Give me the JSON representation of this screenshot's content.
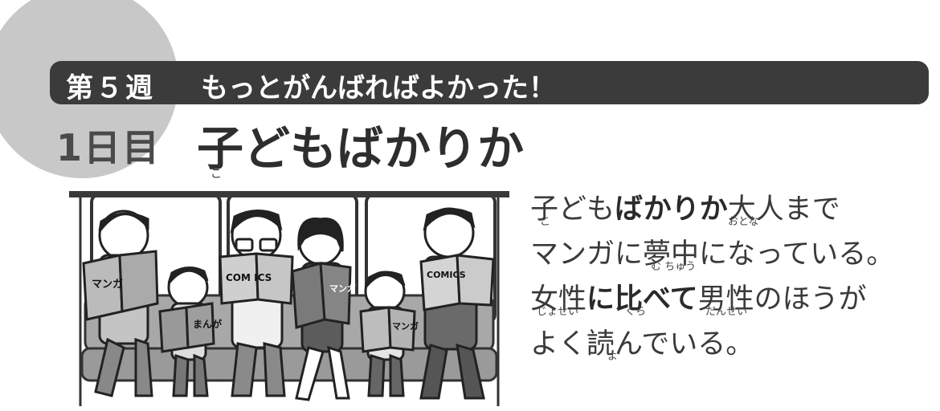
{
  "header": {
    "week_label": "第５週",
    "week_subtitle": "もっとがんばればよかった！",
    "day_label": "1日目",
    "title": "子どもばかりか",
    "title_ruby": "こ"
  },
  "illustration": {
    "book_labels": [
      "マンガ",
      "まんが",
      "COM ICS",
      "マンガ",
      "マンガ",
      "COMICS"
    ]
  },
  "body": {
    "line1": {
      "part1": "子ども",
      "bold": "ばかりか",
      "part2": "大人まで",
      "ruby_ko": "こ",
      "ruby_otona": "おとな"
    },
    "line2": {
      "text": "マンガに夢中になっている。",
      "ruby_muchu": "む ちゅう"
    },
    "line3": {
      "part1": "女性",
      "bold": "に比べて",
      "part2": "男性のほうが",
      "ruby_josei": "じょせい",
      "ruby_kura": "くら",
      "ruby_dansei": "だんせい"
    },
    "line4": {
      "text": "よく読んでいる。",
      "ruby_yo": "よ"
    }
  }
}
